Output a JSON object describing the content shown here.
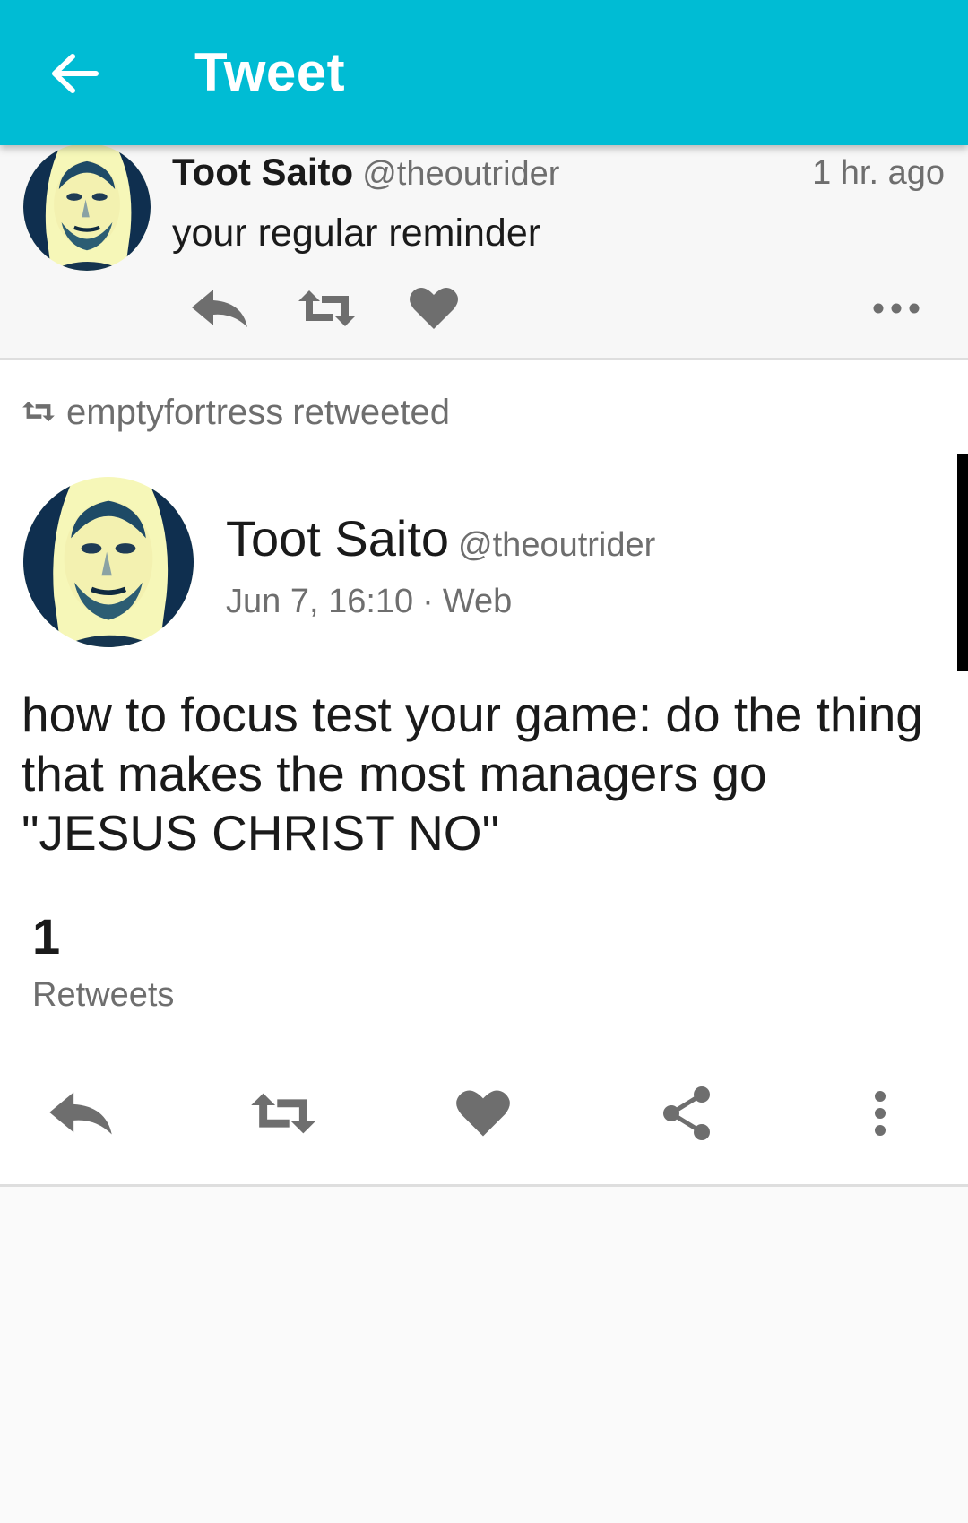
{
  "appbar": {
    "title": "Tweet",
    "back_icon": "arrow-back-icon",
    "background": "#00bcd4"
  },
  "parent_tweet": {
    "author_name": "Toot Saito",
    "author_handle": "@theoutrider",
    "time": "1 hr. ago",
    "text": "your regular reminder",
    "actions": [
      "reply-icon",
      "retweet-icon",
      "heart-icon",
      "more-horizontal-icon"
    ]
  },
  "main_tweet": {
    "retweeted_by_user": "emptyfortress",
    "retweeted_by_suffix": "retweeted",
    "author_name": "Toot Saito",
    "author_handle": "@theoutrider",
    "date": "Jun 7, 16:10",
    "separator": "·",
    "source": "Web",
    "text": "how to focus test your game: do the thing that makes the most managers go \"JESUS CHRIST NO\"",
    "retweet_count": "1",
    "retweet_label": "Retweets",
    "actions": [
      "reply-icon",
      "retweet-icon",
      "heart-icon",
      "share-icon",
      "more-vertical-icon"
    ]
  },
  "colors": {
    "accent": "#00bcd4",
    "icon": "#6e6e6e",
    "text": "#1a1a1a",
    "muted": "#6e6e6e"
  }
}
